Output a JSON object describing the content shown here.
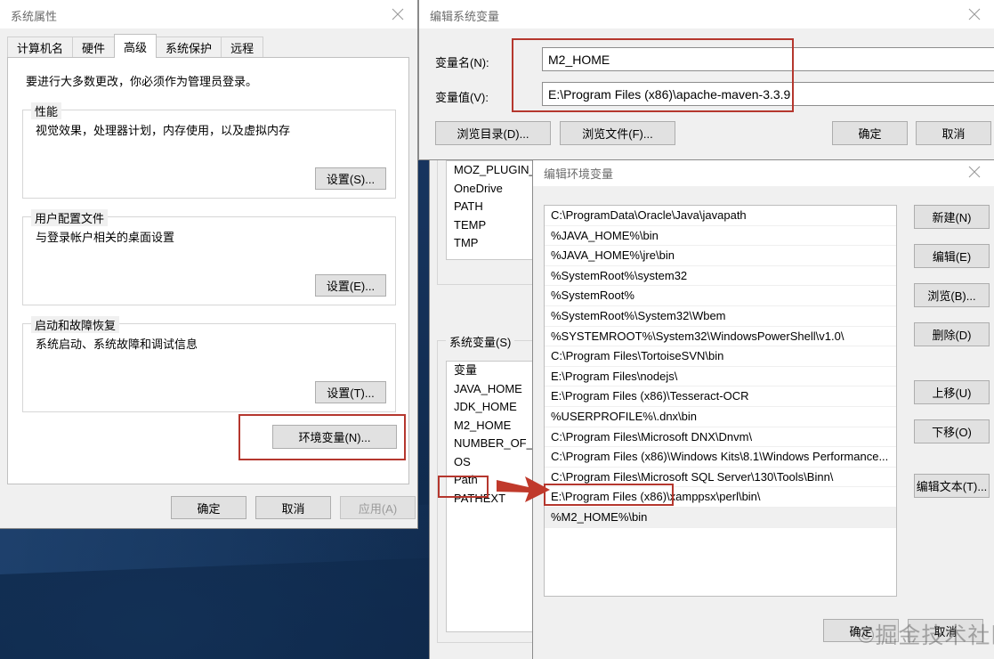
{
  "desktop": {
    "name": "windows-desktop-wallpaper"
  },
  "system_properties": {
    "title": "系统属性",
    "close_icon": "close-icon",
    "tabs": [
      {
        "label": "计算机名",
        "active": false
      },
      {
        "label": "硬件",
        "active": false
      },
      {
        "label": "高级",
        "active": true
      },
      {
        "label": "系统保护",
        "active": false
      },
      {
        "label": "远程",
        "active": false
      }
    ],
    "notice": "要进行大多数更改，你必须作为管理员登录。",
    "groups": [
      {
        "legend": "性能",
        "desc": "视觉效果，处理器计划，内存使用，以及虚拟内存",
        "button": "设置(S)..."
      },
      {
        "legend": "用户配置文件",
        "desc": "与登录帐户相关的桌面设置",
        "button": "设置(E)..."
      },
      {
        "legend": "启动和故障恢复",
        "desc": "系统启动、系统故障和调试信息",
        "button": "设置(T)..."
      }
    ],
    "env_button": "环境变量(N)...",
    "footer_buttons": [
      {
        "label": "确定",
        "disabled": false
      },
      {
        "label": "取消",
        "disabled": false
      },
      {
        "label": "应用(A)",
        "disabled": true
      }
    ]
  },
  "environment_variables_dialog": {
    "user_list_items": [
      "MOZ_PLUGIN_P",
      "OneDrive",
      "PATH",
      "TEMP",
      "TMP"
    ],
    "system_group_legend": "系统变量(S)",
    "system_list_header": "变量",
    "system_list_items": [
      {
        "name": "JAVA_HOME",
        "selected": false
      },
      {
        "name": "JDK_HOME",
        "selected": false
      },
      {
        "name": "M2_HOME",
        "selected": false
      },
      {
        "name": "NUMBER_OF_P",
        "selected": false
      },
      {
        "name": "OS",
        "selected": false
      },
      {
        "name": "Path",
        "selected": true
      },
      {
        "name": "PATHEXT",
        "selected": false
      }
    ]
  },
  "edit_system_variable": {
    "title": "编辑系统变量",
    "close_icon": "close-icon",
    "name_label": "变量名(N):",
    "name_value": "M2_HOME",
    "value_label": "变量值(V):",
    "value_value": "E:\\Program Files (x86)\\apache-maven-3.3.9",
    "browse_dir_button": "浏览目录(D)...",
    "browse_file_button": "浏览文件(F)...",
    "ok_button": "确定",
    "cancel_button": "取消"
  },
  "edit_environment_variable": {
    "title": "编辑环境变量",
    "close_icon": "close-icon",
    "path_entries": [
      {
        "text": "C:\\ProgramData\\Oracle\\Java\\javapath",
        "selected": false
      },
      {
        "text": "%JAVA_HOME%\\bin",
        "selected": false
      },
      {
        "text": "%JAVA_HOME%\\jre\\bin",
        "selected": false
      },
      {
        "text": "%SystemRoot%\\system32",
        "selected": false
      },
      {
        "text": "%SystemRoot%",
        "selected": false
      },
      {
        "text": "%SystemRoot%\\System32\\Wbem",
        "selected": false
      },
      {
        "text": "%SYSTEMROOT%\\System32\\WindowsPowerShell\\v1.0\\",
        "selected": false
      },
      {
        "text": "C:\\Program Files\\TortoiseSVN\\bin",
        "selected": false
      },
      {
        "text": "E:\\Program Files\\nodejs\\",
        "selected": false
      },
      {
        "text": "E:\\Program Files (x86)\\Tesseract-OCR",
        "selected": false
      },
      {
        "text": "%USERPROFILE%\\.dnx\\bin",
        "selected": false
      },
      {
        "text": "C:\\Program Files\\Microsoft DNX\\Dnvm\\",
        "selected": false
      },
      {
        "text": "C:\\Program Files (x86)\\Windows Kits\\8.1\\Windows Performance...",
        "selected": false
      },
      {
        "text": "C:\\Program Files\\Microsoft SQL Server\\130\\Tools\\Binn\\",
        "selected": false
      },
      {
        "text": "E:\\Program Files (x86)\\xamppsx\\perl\\bin\\",
        "selected": false
      },
      {
        "text": "%M2_HOME%\\bin",
        "selected": true
      }
    ],
    "side_buttons": [
      "新建(N)",
      "编辑(E)",
      "浏览(B)...",
      "删除(D)",
      "上移(U)",
      "下移(O)",
      "编辑文本(T)..."
    ],
    "ok_button": "确定",
    "cancel_button": "取消"
  },
  "annotations": {
    "highlight_color": "#b5372e",
    "arrow_name": "red-arrow-path-to-entry",
    "boxes": [
      "env-button-highlight",
      "variable-fields-highlight",
      "path-row-highlight",
      "m2home-entry-highlight"
    ]
  },
  "watermark": {
    "text": "©掘金技术社区"
  }
}
